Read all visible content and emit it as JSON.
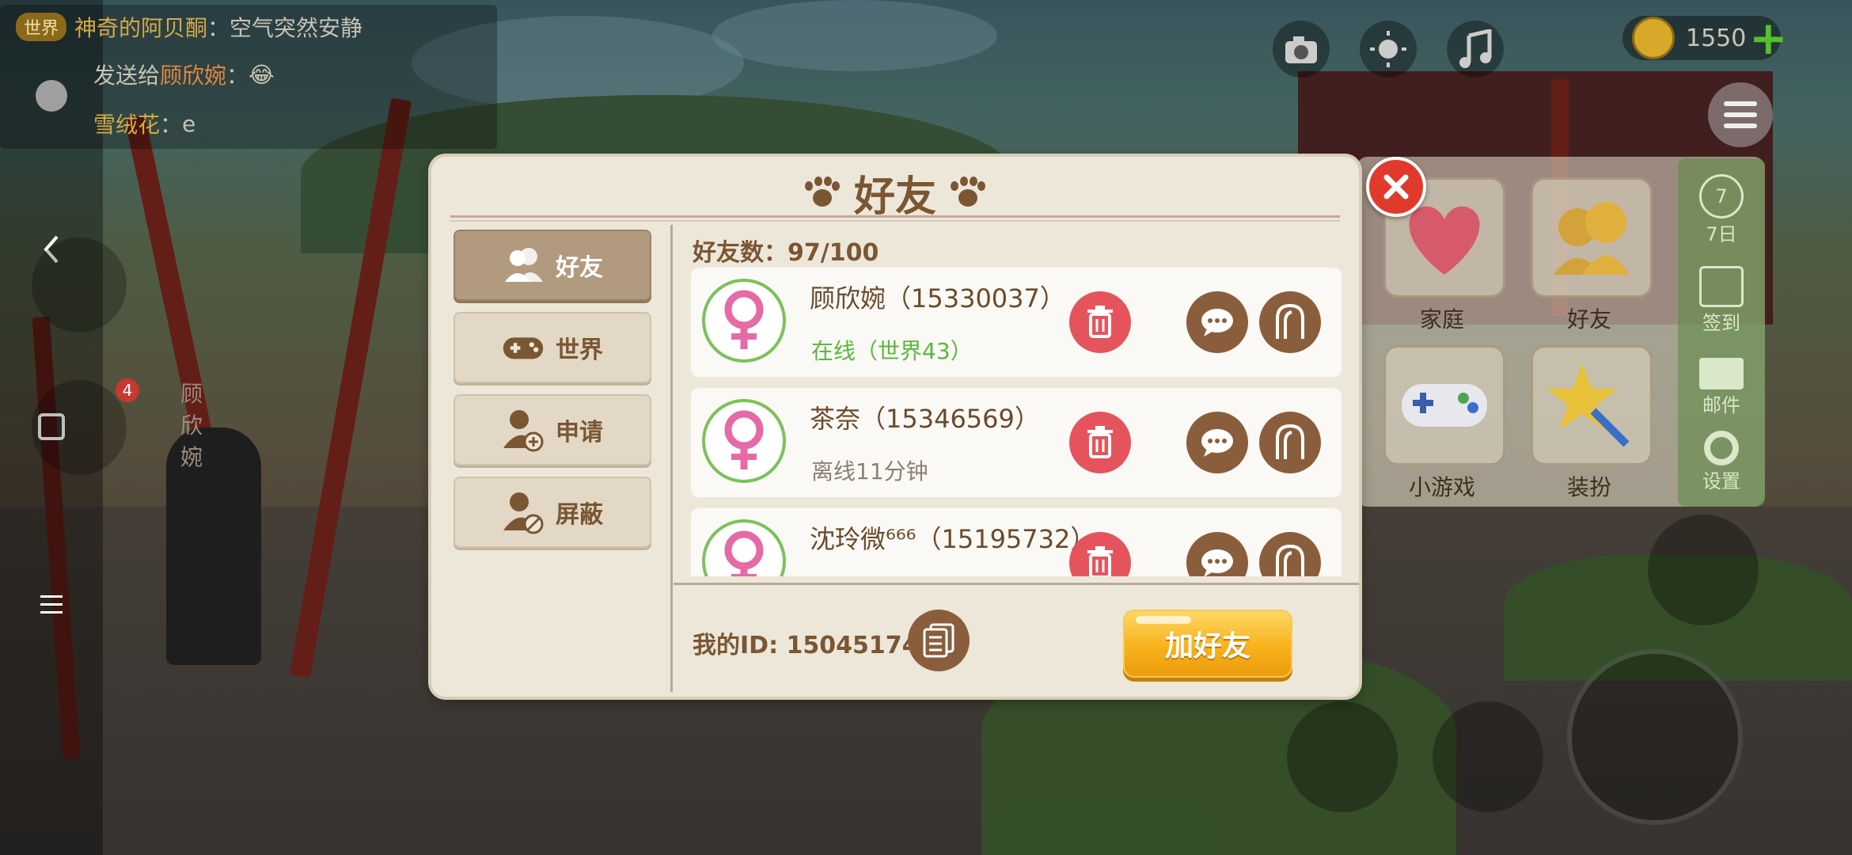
{
  "chat": {
    "lines": [
      {
        "tag": "世界",
        "name": "神奇的阿贝酮",
        "sep": "：",
        "text": "空气突然安静"
      },
      {
        "tag": "",
        "prefix": "发送给",
        "name": "顾欣婉",
        "sep": "：",
        "text": "😂"
      },
      {
        "tag": "",
        "name": "雪绒花",
        "sep": "：",
        "text": "e"
      }
    ]
  },
  "hud": {
    "coins": "1550",
    "add_label": "+",
    "world_player_name": "顾欣婉",
    "notification_count": "4"
  },
  "side_menu": {
    "tiles": [
      {
        "label": "家庭",
        "icon": "heart-icon"
      },
      {
        "label": "好友",
        "icon": "friends-icon"
      },
      {
        "label": "小游戏",
        "icon": "gamepad-icon"
      },
      {
        "label": "装扮",
        "icon": "star-wand-icon"
      }
    ],
    "strip": [
      {
        "label": "7日",
        "icon": "seven-day-icon"
      },
      {
        "label": "签到",
        "icon": "checkin-icon"
      },
      {
        "label": "邮件",
        "icon": "mail-icon"
      },
      {
        "label": "设置",
        "icon": "gear-icon"
      }
    ]
  },
  "dialog": {
    "title": "好友",
    "tabs": [
      {
        "label": "好友",
        "icon": "friends-icon",
        "active": true
      },
      {
        "label": "世界",
        "icon": "gamepad-icon",
        "active": false
      },
      {
        "label": "申请",
        "icon": "add-person-icon",
        "active": false
      },
      {
        "label": "屏蔽",
        "icon": "block-person-icon",
        "active": false
      }
    ],
    "friend_count_label": "好友数：",
    "friend_count_value": "97/100",
    "friends": [
      {
        "name": "顾欣婉（15330037）",
        "status": "在线（世界43）",
        "online": true,
        "gender": "female"
      },
      {
        "name": "茶奈（15346569）",
        "status": "离线11分钟",
        "online": false,
        "gender": "female"
      },
      {
        "name": "沈玲微⁶⁶⁶（15195732）",
        "status": "",
        "online": false,
        "gender": "female"
      }
    ],
    "my_id_label": "我的ID:",
    "my_id_value": "15045174",
    "add_friend_label": "加好友"
  }
}
